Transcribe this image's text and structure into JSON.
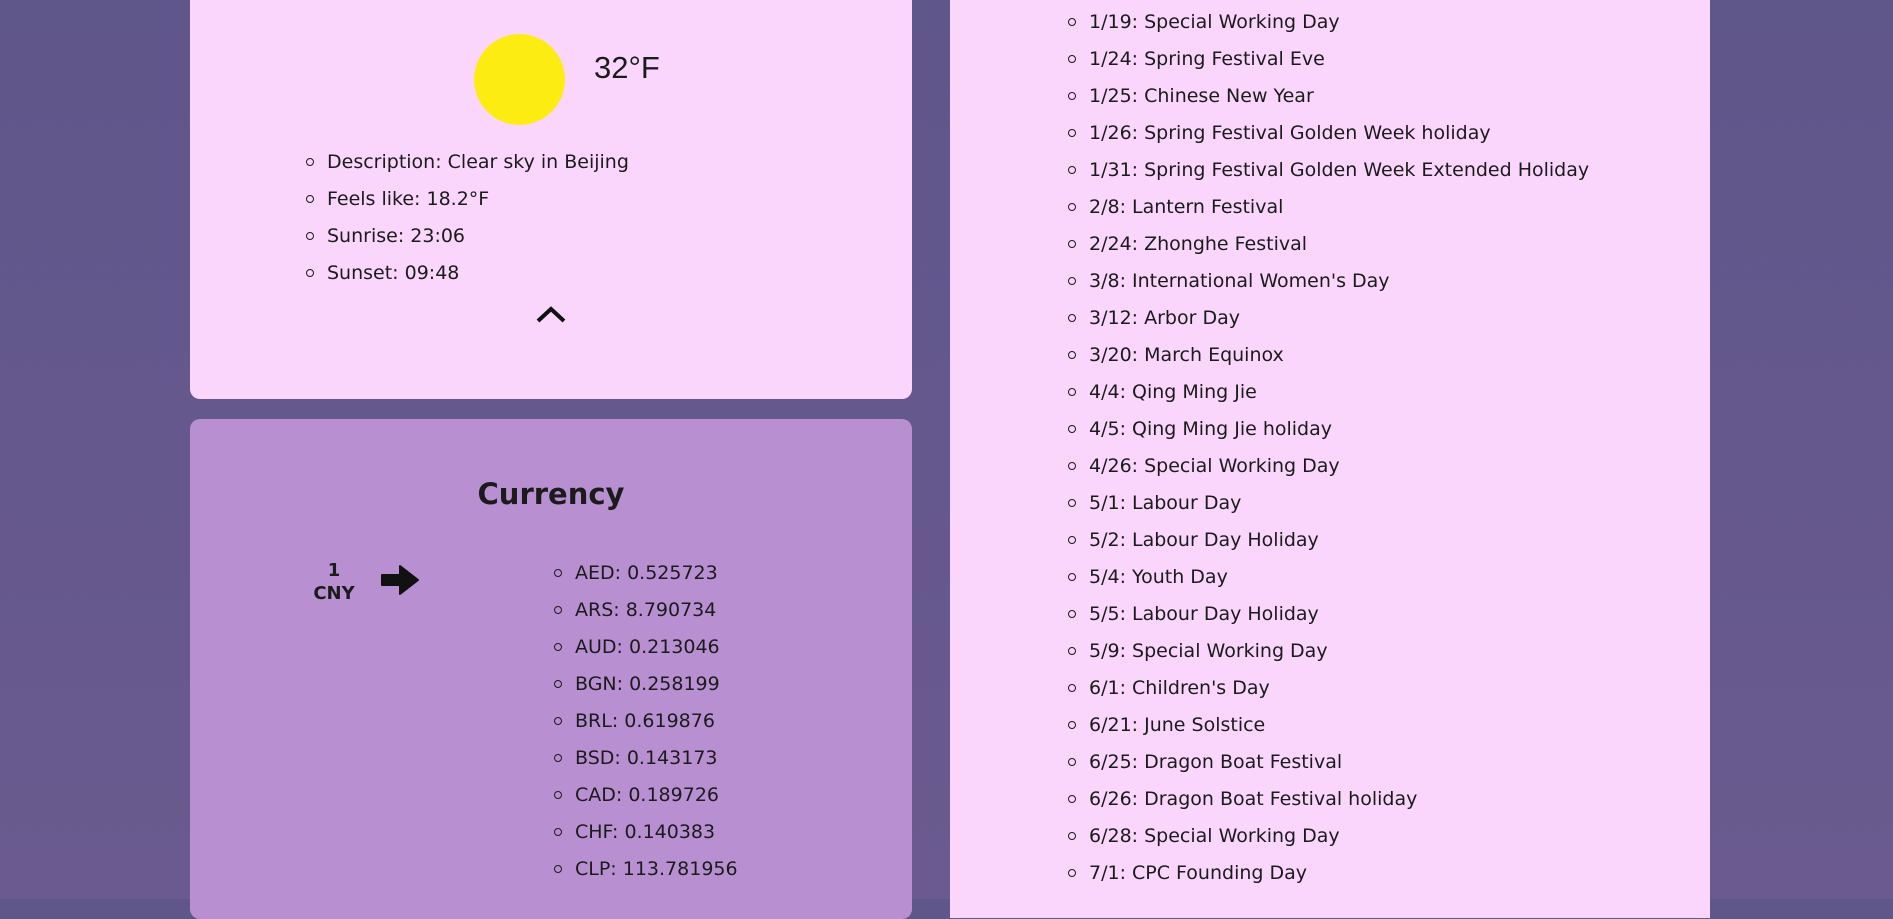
{
  "weather": {
    "temperature": "32°F",
    "details": [
      "Description: Clear sky in Beijing",
      "Feels like: 18.2°F",
      "Sunrise: 23:06",
      "Sunset: 09:48"
    ]
  },
  "currency": {
    "title": "Currency",
    "base_amount": "1",
    "base_code": "CNY",
    "rates": [
      "AED: 0.525723",
      "ARS: 8.790734",
      "AUD: 0.213046",
      "BGN: 0.258199",
      "BRL: 0.619876",
      "BSD: 0.143173",
      "CAD: 0.189726",
      "CHF: 0.140383",
      "CLP: 113.781956"
    ]
  },
  "holidays": [
    "1/19: Special Working Day",
    "1/24: Spring Festival Eve",
    "1/25: Chinese New Year",
    "1/26: Spring Festival Golden Week holiday",
    "1/31: Spring Festival Golden Week Extended Holiday",
    "2/8: Lantern Festival",
    "2/24: Zhonghe Festival",
    "3/8: International Women's Day",
    "3/12: Arbor Day",
    "3/20: March Equinox",
    "4/4: Qing Ming Jie",
    "4/5: Qing Ming Jie holiday",
    "4/26: Special Working Day",
    "5/1: Labour Day",
    "5/2: Labour Day Holiday",
    "5/4: Youth Day",
    "5/5: Labour Day Holiday",
    "5/9: Special Working Day",
    "6/1: Children's Day",
    "6/21: June Solstice",
    "6/25: Dragon Boat Festival",
    "6/26: Dragon Boat Festival holiday",
    "6/28: Special Working Day",
    "7/1: CPC Founding Day"
  ],
  "icons": {
    "weather": "sun-icon",
    "collapse": "chevron-up-icon",
    "conversion": "arrow-right-icon"
  },
  "colors": {
    "background": "#5f568a",
    "card_pink": "#fad6fd",
    "card_purple": "#b890d2",
    "sun": "#fcec12"
  }
}
